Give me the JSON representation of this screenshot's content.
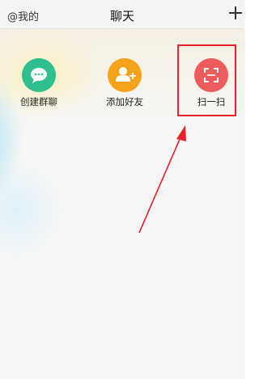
{
  "header": {
    "left_label": "@我的",
    "title": "聊天"
  },
  "actions": [
    {
      "label": "创建群聊",
      "icon": "chat-bubble-icon",
      "color": "#2dbf8f"
    },
    {
      "label": "添加好友",
      "icon": "add-person-icon",
      "color": "#f6a31c"
    },
    {
      "label": "扫一扫",
      "icon": "scan-icon",
      "color": "#ec5c5c"
    }
  ],
  "colors": {
    "annotation": "#e8232e"
  }
}
